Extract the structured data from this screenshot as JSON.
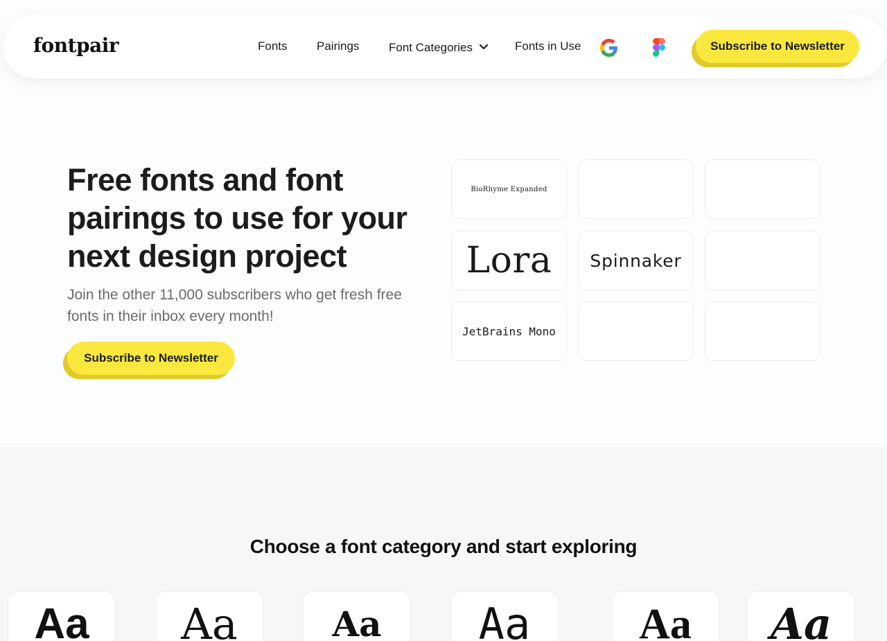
{
  "header": {
    "logo": "fontpair",
    "nav": [
      {
        "label": "Fonts"
      },
      {
        "label": "Pairings"
      },
      {
        "label": "Font Categories"
      },
      {
        "label": "Fonts in Use"
      }
    ],
    "icons": [
      "google-icon",
      "figma-icon"
    ],
    "cta_label": "Subscribe to Newsletter"
  },
  "hero": {
    "title": "Free fonts and font pairings to use for your next design project",
    "subtitle": "Join the other 11,000 subscribers who get fresh free fonts in their inbox every month!",
    "cta_label": "Subscribe to Newsletter",
    "tiles": [
      "BioRhyme Expanded",
      "",
      "",
      "Lora",
      "Spinnaker",
      "",
      "JetBrains Mono",
      "",
      ""
    ]
  },
  "categories": {
    "title": "Choose a font category and start exploring",
    "samples": [
      "Aa",
      "Aa",
      "Aa",
      "Aa",
      "Aa",
      "Aa"
    ]
  },
  "colors": {
    "accent": "#fbe83e",
    "accent_shadow": "#e0ca2c",
    "page_bg": "#fcfdfe",
    "section_bg": "#f6f7f7"
  }
}
